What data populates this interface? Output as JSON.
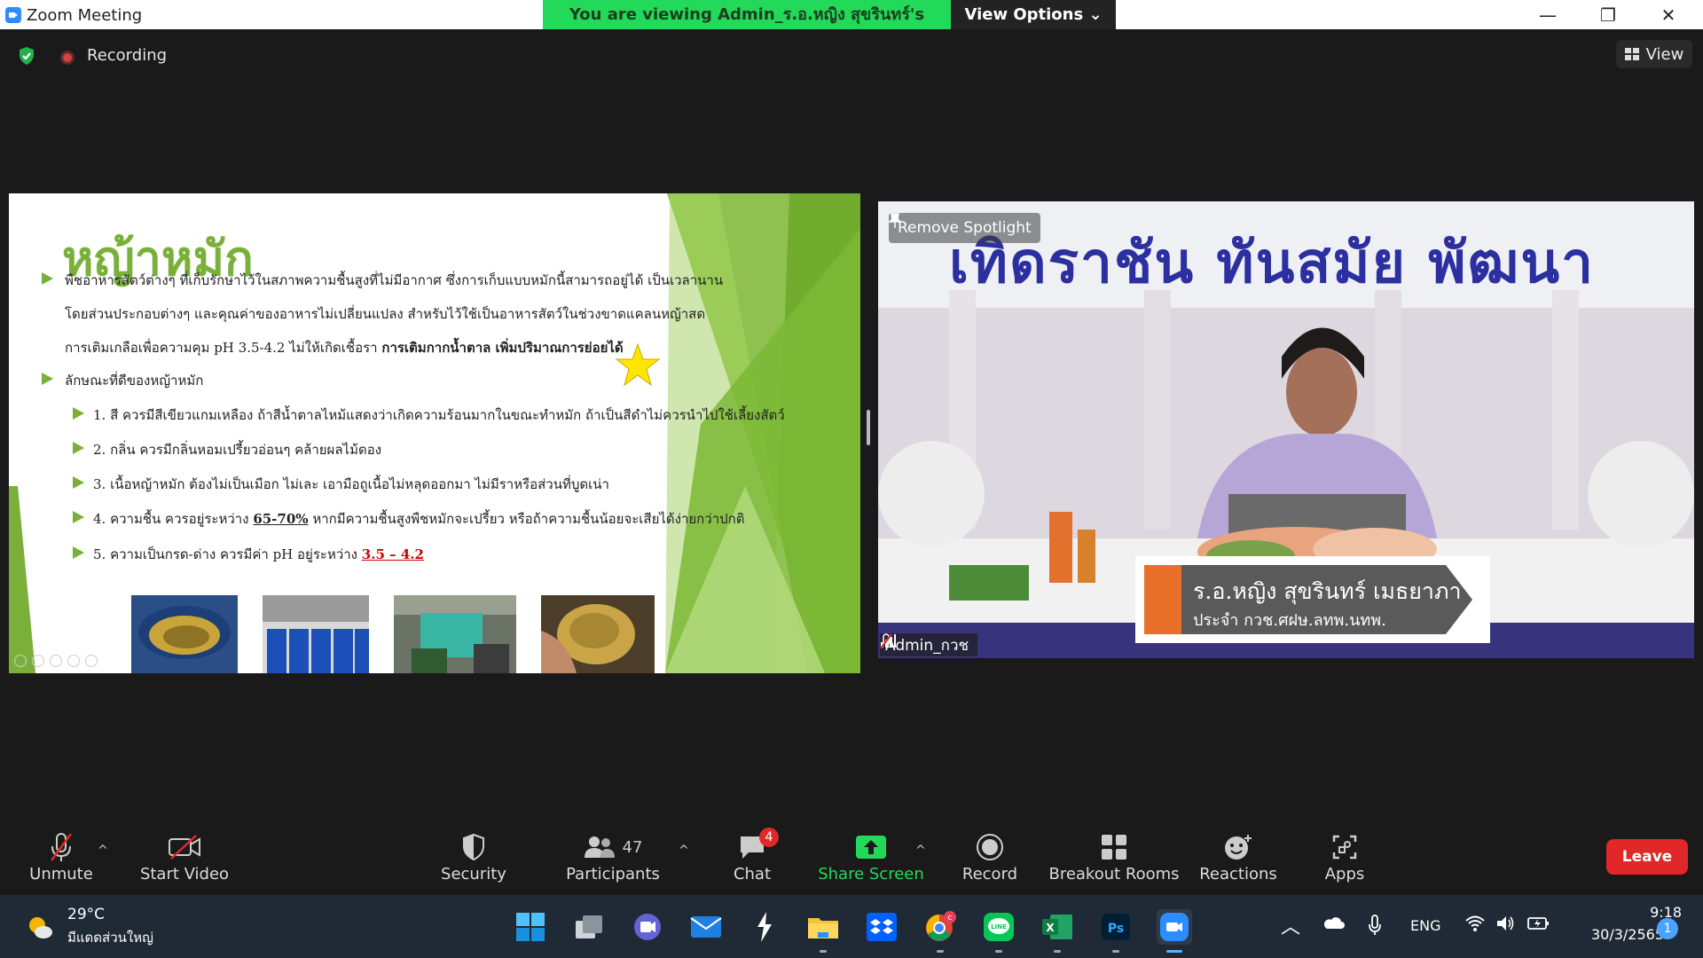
{
  "window": {
    "title": "Zoom Meeting",
    "viewing_banner": "You are viewing Admin_ร.อ.หญิง สุขรินทร์'s screen",
    "view_options": "View Options ⌄",
    "minimize": "—",
    "restore": "❐",
    "close": "✕"
  },
  "status": {
    "recording_label": "Recording",
    "view_label": "View"
  },
  "slide": {
    "title": "หญ้าหมัก",
    "line1": "พืชอาหารสัตว์ต่างๆ ที่เก็บรักษาไว้ในสภาพความชื้นสูงที่ไม่มีอากาศ ซึ่งการเก็บแบบหมักนี้สามารถอยู่ได้ เป็นเวลานาน",
    "line2": "โดยส่วนประกอบต่างๆ และคุณค่าของอาหารไม่เปลี่ยนแปลง สำหรับไว้ใช้เป็นอาหารสัตว์ในช่วงขาดแคลนหญ้าสด",
    "line3_a": "การเติมเกลือเพื่อความคุม pH 3.5-4.2  ไม่ให้เกิดเชื้อรา ",
    "line3_b": "การเติมกากน้ำตาล เพิ่มปริมาณการย่อยได้",
    "line4": "ลักษณะที่ดีของหญ้าหมัก",
    "item1": "1. สี ควรมีสีเขียวแกมเหลือง ถ้าสีน้ำตาลไหม้แสดงว่าเกิดความร้อนมากในขณะทำหมัก ถ้าเป็นสีดำไม่ควรนำไปใช้เลี้ยงสัตว์",
    "item2": "2. กลิ่น ควรมีกลิ่นหอมเปรี้ยวอ่อนๆ คล้ายผลไม้ดอง",
    "item3": "3. เนื้อหญ้าหมัก ต้องไม่เป็นเมือก ไม่เละ เอามือถูเนื้อไม่หลุดออกมา ไม่มีราหรือส่วนที่บูดเน่า",
    "item4_a": "4. ความชื้น ควรอยู่ระหว่าง ",
    "item4_b": "65-70%",
    "item4_c": " หากมีความชื้นสูงพืชหมักจะเปรี้ยว หรือถ้าความชื้นน้อยจะเสียได้ง่ายกว่าปกติ",
    "item5_a": "5. ความเป็นกรด-ด่าง ควรมีค่า pH อยู่ระหว่าง ",
    "item5_b": "3.5 – 4.2"
  },
  "video": {
    "remove_spotlight": "Remove Spotlight",
    "participant_name": "Admin_กวช",
    "stage_words": "เทิดราชัน    ทันสมัย    พัฒนา",
    "banner_name": "ร.อ.หญิง สุขรินทร์  เมธยาภา",
    "banner_role": "ประจำ กวช.ศฝษ.ลทพ.นทพ."
  },
  "toolbar": {
    "unmute": "Unmute",
    "start_video": "Start Video",
    "security": "Security",
    "participants": "Participants",
    "participants_count": "47",
    "chat": "Chat",
    "chat_badge": "4",
    "share_screen": "Share Screen",
    "record": "Record",
    "breakout_rooms": "Breakout Rooms",
    "reactions": "Reactions",
    "apps": "Apps",
    "leave": "Leave"
  },
  "taskbar": {
    "weather_temp": "29°C",
    "weather_desc": "มีแดดส่วนใหญ่",
    "lang": "ENG",
    "time": "9:18",
    "date": "30/3/2565",
    "notifications": "1",
    "chrome_badge": "c"
  },
  "colors": {
    "green_accent": "#23d959",
    "slide_green": "#7ab03a",
    "leave_red": "#e02828",
    "taskbar_bg": "#1f2a36"
  }
}
